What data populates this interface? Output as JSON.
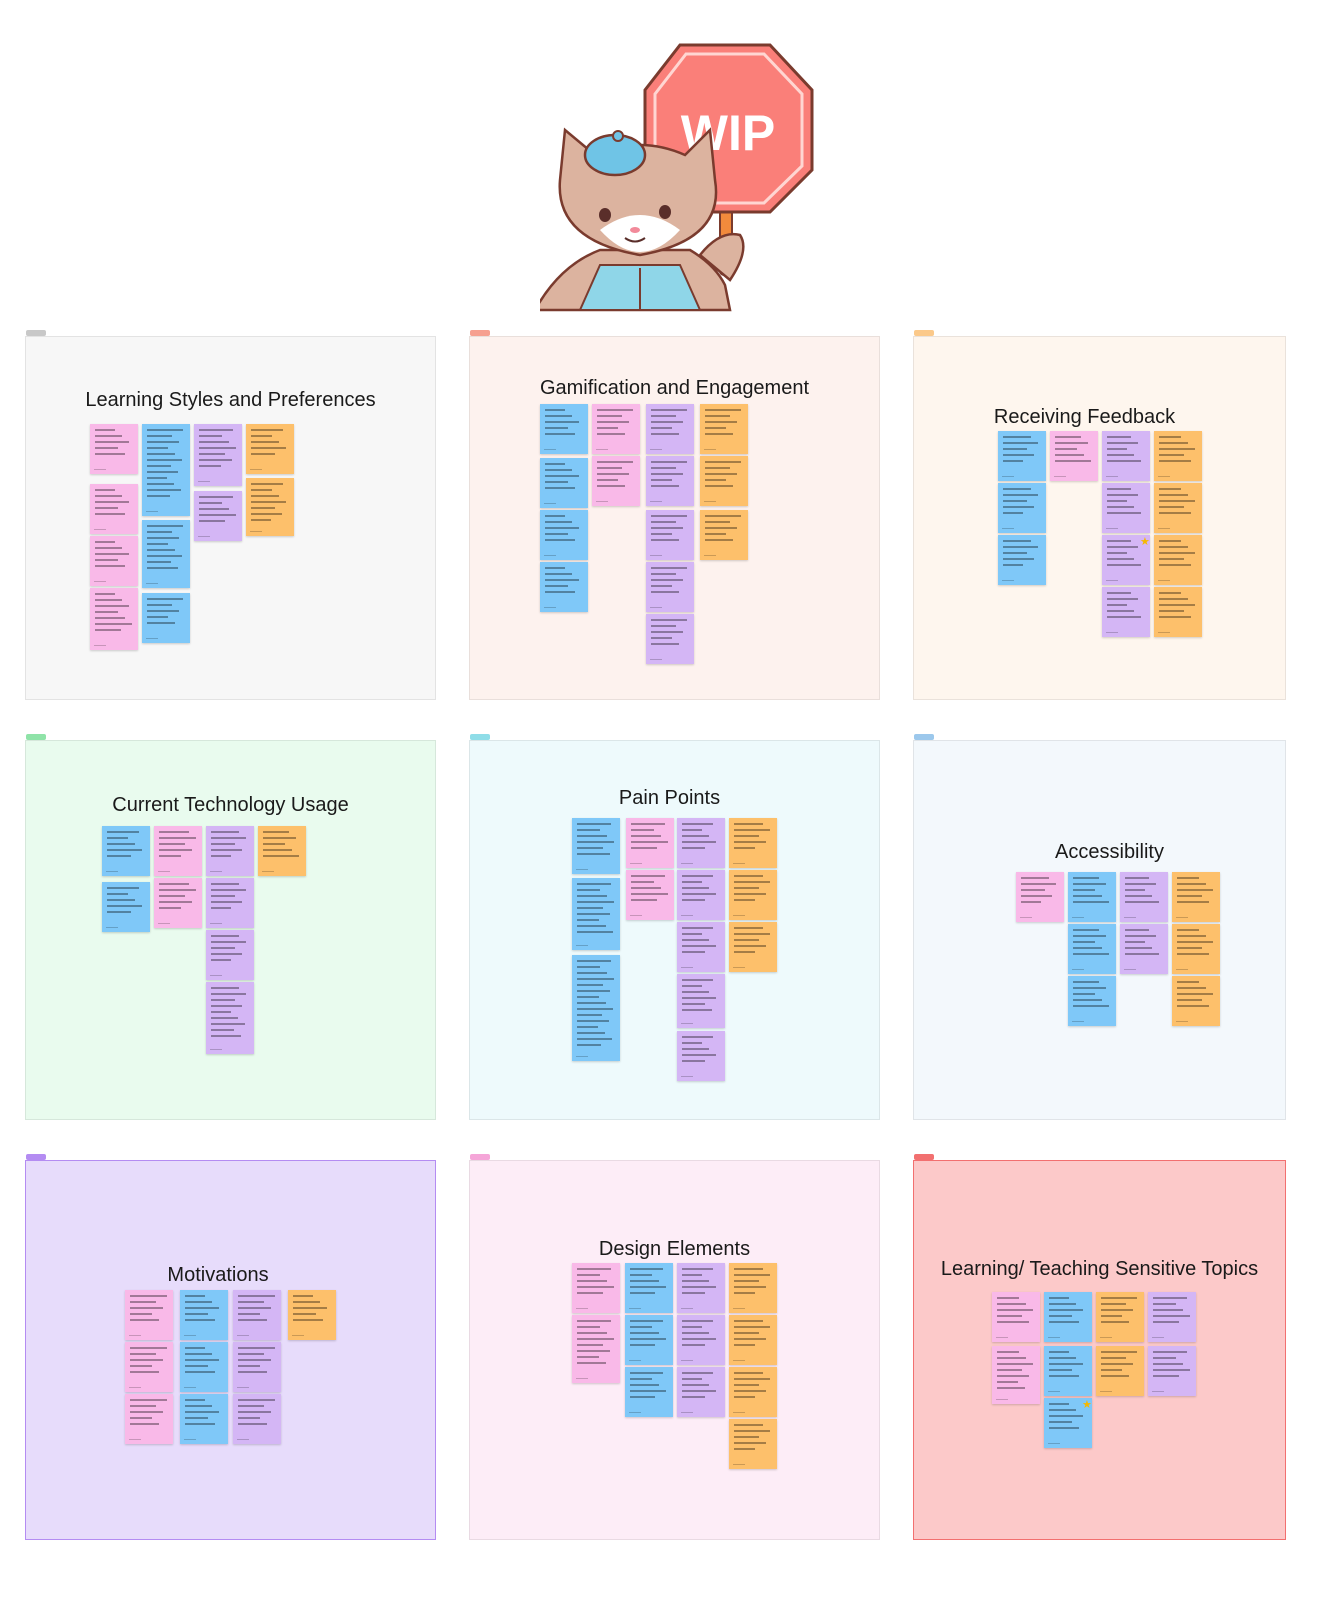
{
  "sticker": {
    "sign_text": "WIP"
  },
  "sections": [
    {
      "title": "Learning Styles and Preferences",
      "bg": "#f7f7f7",
      "tag_color": "#c8c8c8"
    },
    {
      "title": "Gamification and Engagement",
      "bg": "#fdf2ee",
      "tag_color": "#f6a090"
    },
    {
      "title": "Receiving Feedback",
      "bg": "#fef6ee",
      "tag_color": "#fbc98a"
    },
    {
      "title": "Current Technology Usage",
      "bg": "#e9fbee",
      "tag_color": "#8fe3a8"
    },
    {
      "title": "Pain Points",
      "bg": "#eefafc",
      "tag_color": "#8fdde8"
    },
    {
      "title": "Accessibility",
      "bg": "#f3f8fc",
      "tag_color": "#9cc8ec"
    },
    {
      "title": "Motivations",
      "bg": "#e7dcfb",
      "tag_color": "#b48cf2"
    },
    {
      "title": "Design Elements",
      "bg": "#fdedf7",
      "tag_color": "#f5a5d8"
    },
    {
      "title": "Learning/ Teaching Sensitive Topics",
      "bg": "#fcc9c9",
      "tag_color": "#f27070"
    }
  ],
  "colors": {
    "pink": "#f9b9e8",
    "blue": "#7fc8f8",
    "purple": "#d4b6f5",
    "orange": "#fdc06b"
  }
}
